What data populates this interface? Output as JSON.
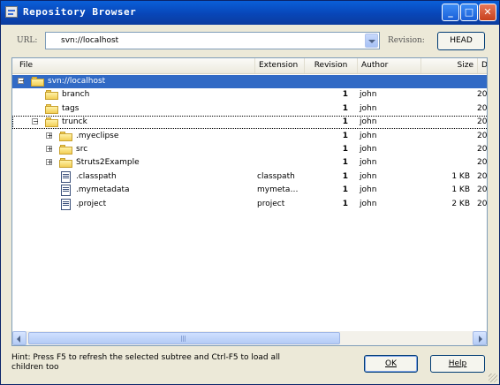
{
  "window": {
    "title": "Repository Browser",
    "minimize_glyph": "_",
    "maximize_glyph": "□",
    "close_glyph": "✕"
  },
  "toolbar": {
    "url_label": "URL:",
    "url_value": "svn://localhost",
    "revision_label": "Revision:",
    "head_label": "HEAD"
  },
  "columns": {
    "file": "File",
    "extension": "Extension",
    "revision": "Revision",
    "author": "Author",
    "size": "Size",
    "date": "Da"
  },
  "rows": [
    {
      "name": "svn://localhost",
      "extension": "",
      "revision": "",
      "author": "",
      "size": "",
      "date": "",
      "icon": "folder-icon",
      "expander": "−",
      "selected": true
    },
    {
      "name": "branch",
      "extension": "",
      "revision": "1",
      "author": "john",
      "size": "",
      "date": "20",
      "icon": "folder-icon",
      "expander": ""
    },
    {
      "name": "tags",
      "extension": "",
      "revision": "1",
      "author": "john",
      "size": "",
      "date": "20",
      "icon": "folder-icon",
      "expander": ""
    },
    {
      "name": "trunck",
      "extension": "",
      "revision": "1",
      "author": "john",
      "size": "",
      "date": "20",
      "icon": "folder-icon",
      "expander": "−",
      "focused": true
    },
    {
      "name": ".myeclipse",
      "extension": "",
      "revision": "1",
      "author": "john",
      "size": "",
      "date": "20",
      "icon": "folder-icon",
      "expander": "+"
    },
    {
      "name": "src",
      "extension": "",
      "revision": "1",
      "author": "john",
      "size": "",
      "date": "20",
      "icon": "folder-icon",
      "expander": "+"
    },
    {
      "name": "Struts2Example",
      "extension": "",
      "revision": "1",
      "author": "john",
      "size": "",
      "date": "20",
      "icon": "folder-icon",
      "expander": "+"
    },
    {
      "name": ".classpath",
      "extension": "classpath",
      "revision": "1",
      "author": "john",
      "size": "1 KB",
      "date": "20",
      "icon": "file-icon",
      "expander": ""
    },
    {
      "name": ".mymetadata",
      "extension": "mymeta…",
      "revision": "1",
      "author": "john",
      "size": "1 KB",
      "date": "20",
      "icon": "file-icon",
      "expander": ""
    },
    {
      "name": ".project",
      "extension": "project",
      "revision": "1",
      "author": "john",
      "size": "2 KB",
      "date": "20",
      "icon": "file-icon",
      "expander": ""
    }
  ],
  "footer": {
    "hint": "Hint: Press F5 to refresh the selected subtree and Ctrl-F5 to load all children too",
    "ok_label": "OK",
    "help_label": "Help"
  },
  "colors": {
    "titlebar": "#0a5fd8",
    "selection": "#316ac5",
    "dialog_bg": "#ece9d8"
  }
}
